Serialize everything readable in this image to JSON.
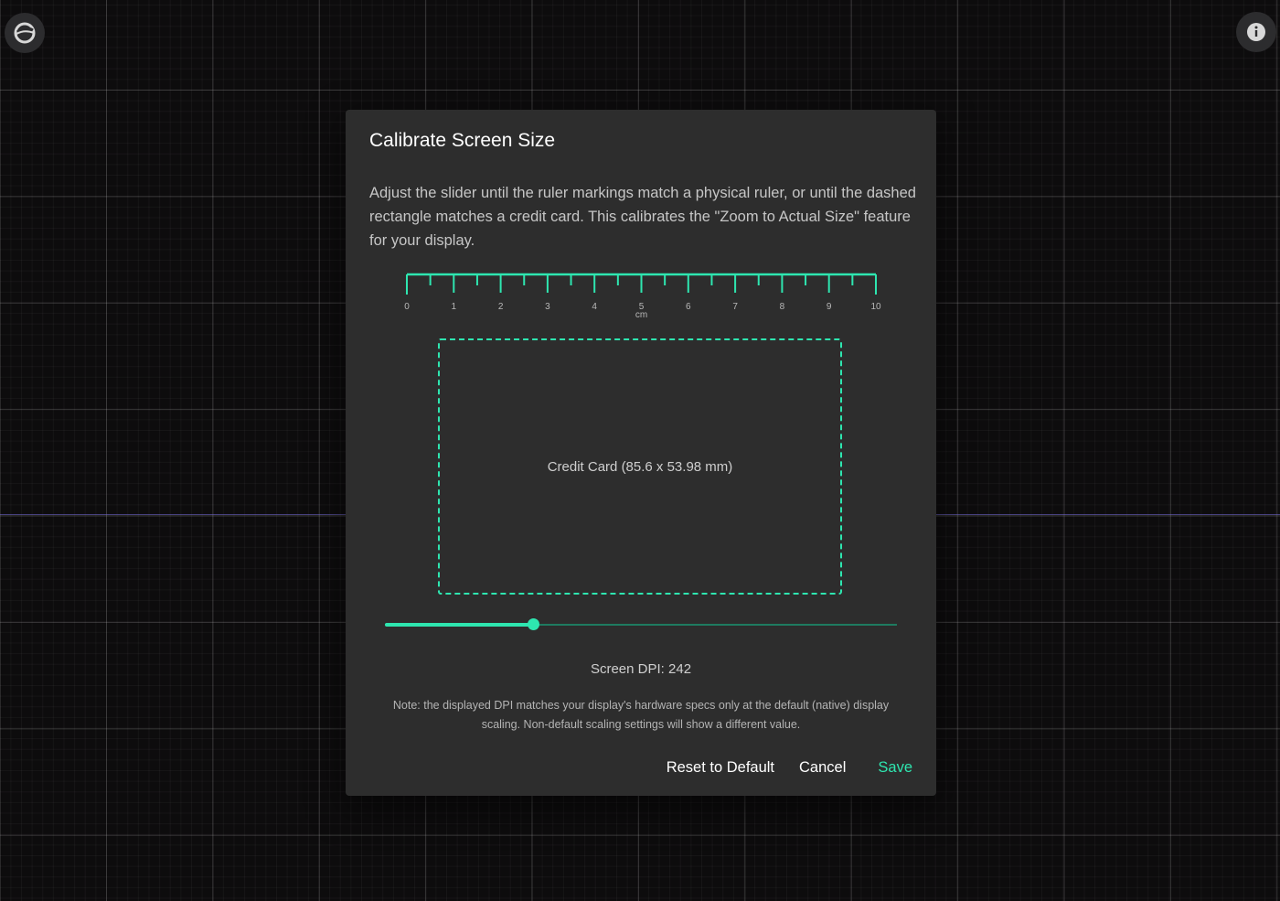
{
  "dialog": {
    "title": "Calibrate Screen Size",
    "description": "Adjust the slider until the ruler markings match a physical ruler, or until the dashed rectangle matches a credit card. This calibrates the \"Zoom to Actual Size\" feature for your display.",
    "ruler": {
      "labels": [
        "0",
        "1",
        "2",
        "3",
        "4",
        "5",
        "6",
        "7",
        "8",
        "9",
        "10"
      ],
      "unit": "cm"
    },
    "card_label": "Credit Card (85.6 x 53.98 mm)",
    "slider": {
      "fraction": 0.29
    },
    "dpi_label": "Screen DPI: 242",
    "note": "Note: the displayed DPI matches your display's hardware specs only at the default (native) display scaling. Non-default scaling settings will show a different value.",
    "buttons": {
      "reset": "Reset to Default",
      "cancel": "Cancel",
      "save": "Save"
    }
  },
  "corner": {
    "left_icon": "app-logo-icon",
    "right_icon": "info-icon"
  },
  "colors": {
    "accent": "#2ee6b0",
    "dialog_bg": "#2d2d2d",
    "canvas_bg": "#121012"
  }
}
